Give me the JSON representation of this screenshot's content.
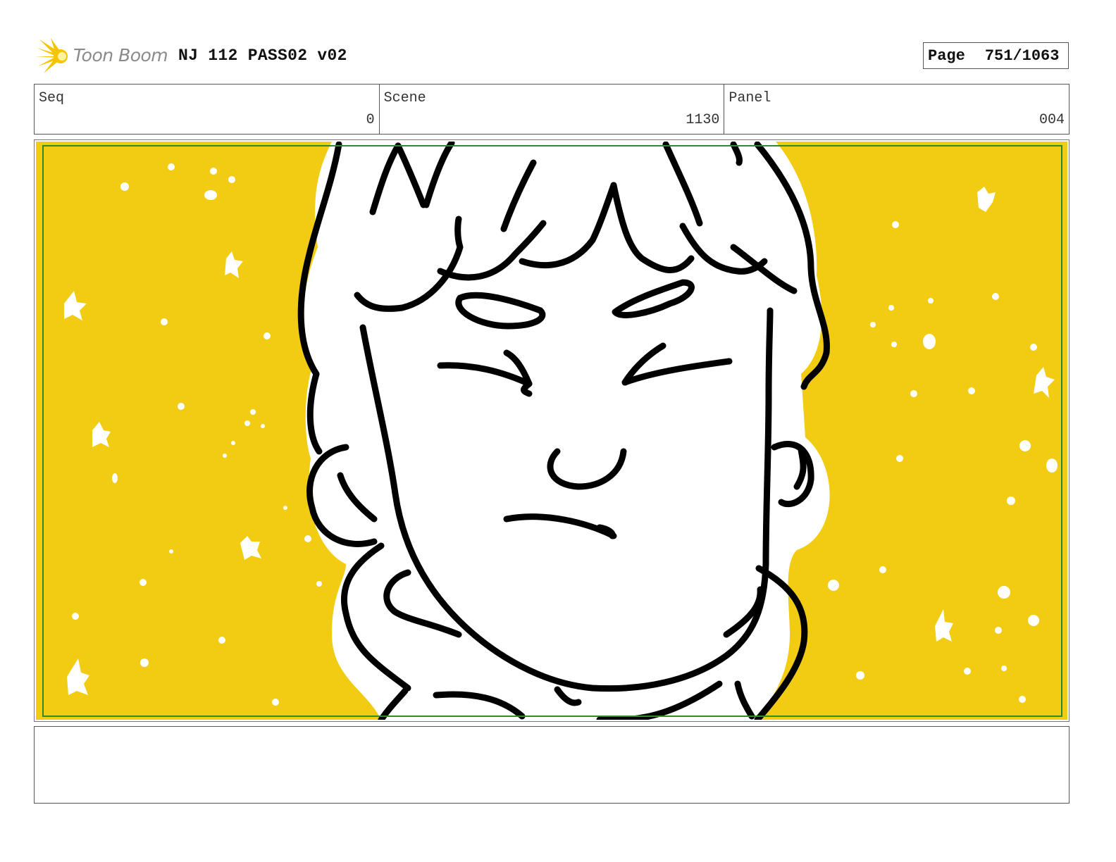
{
  "header": {
    "logo_text": "Toon Boom",
    "title": "NJ 112 PASS02 v02",
    "page_label": "Page",
    "page_value": "751/1063"
  },
  "info": {
    "seq": {
      "label": "Seq",
      "value": "0"
    },
    "scene": {
      "label": "Scene",
      "value": "1130"
    },
    "panel": {
      "label": "Panel",
      "value": "004"
    }
  },
  "artwork": {
    "description_icon": "boy-face-squinting-drawing",
    "background_color": "#f2cb13",
    "frame_color": "#2f8a2f",
    "line_color": "#000000"
  },
  "notes": {
    "text": ""
  }
}
